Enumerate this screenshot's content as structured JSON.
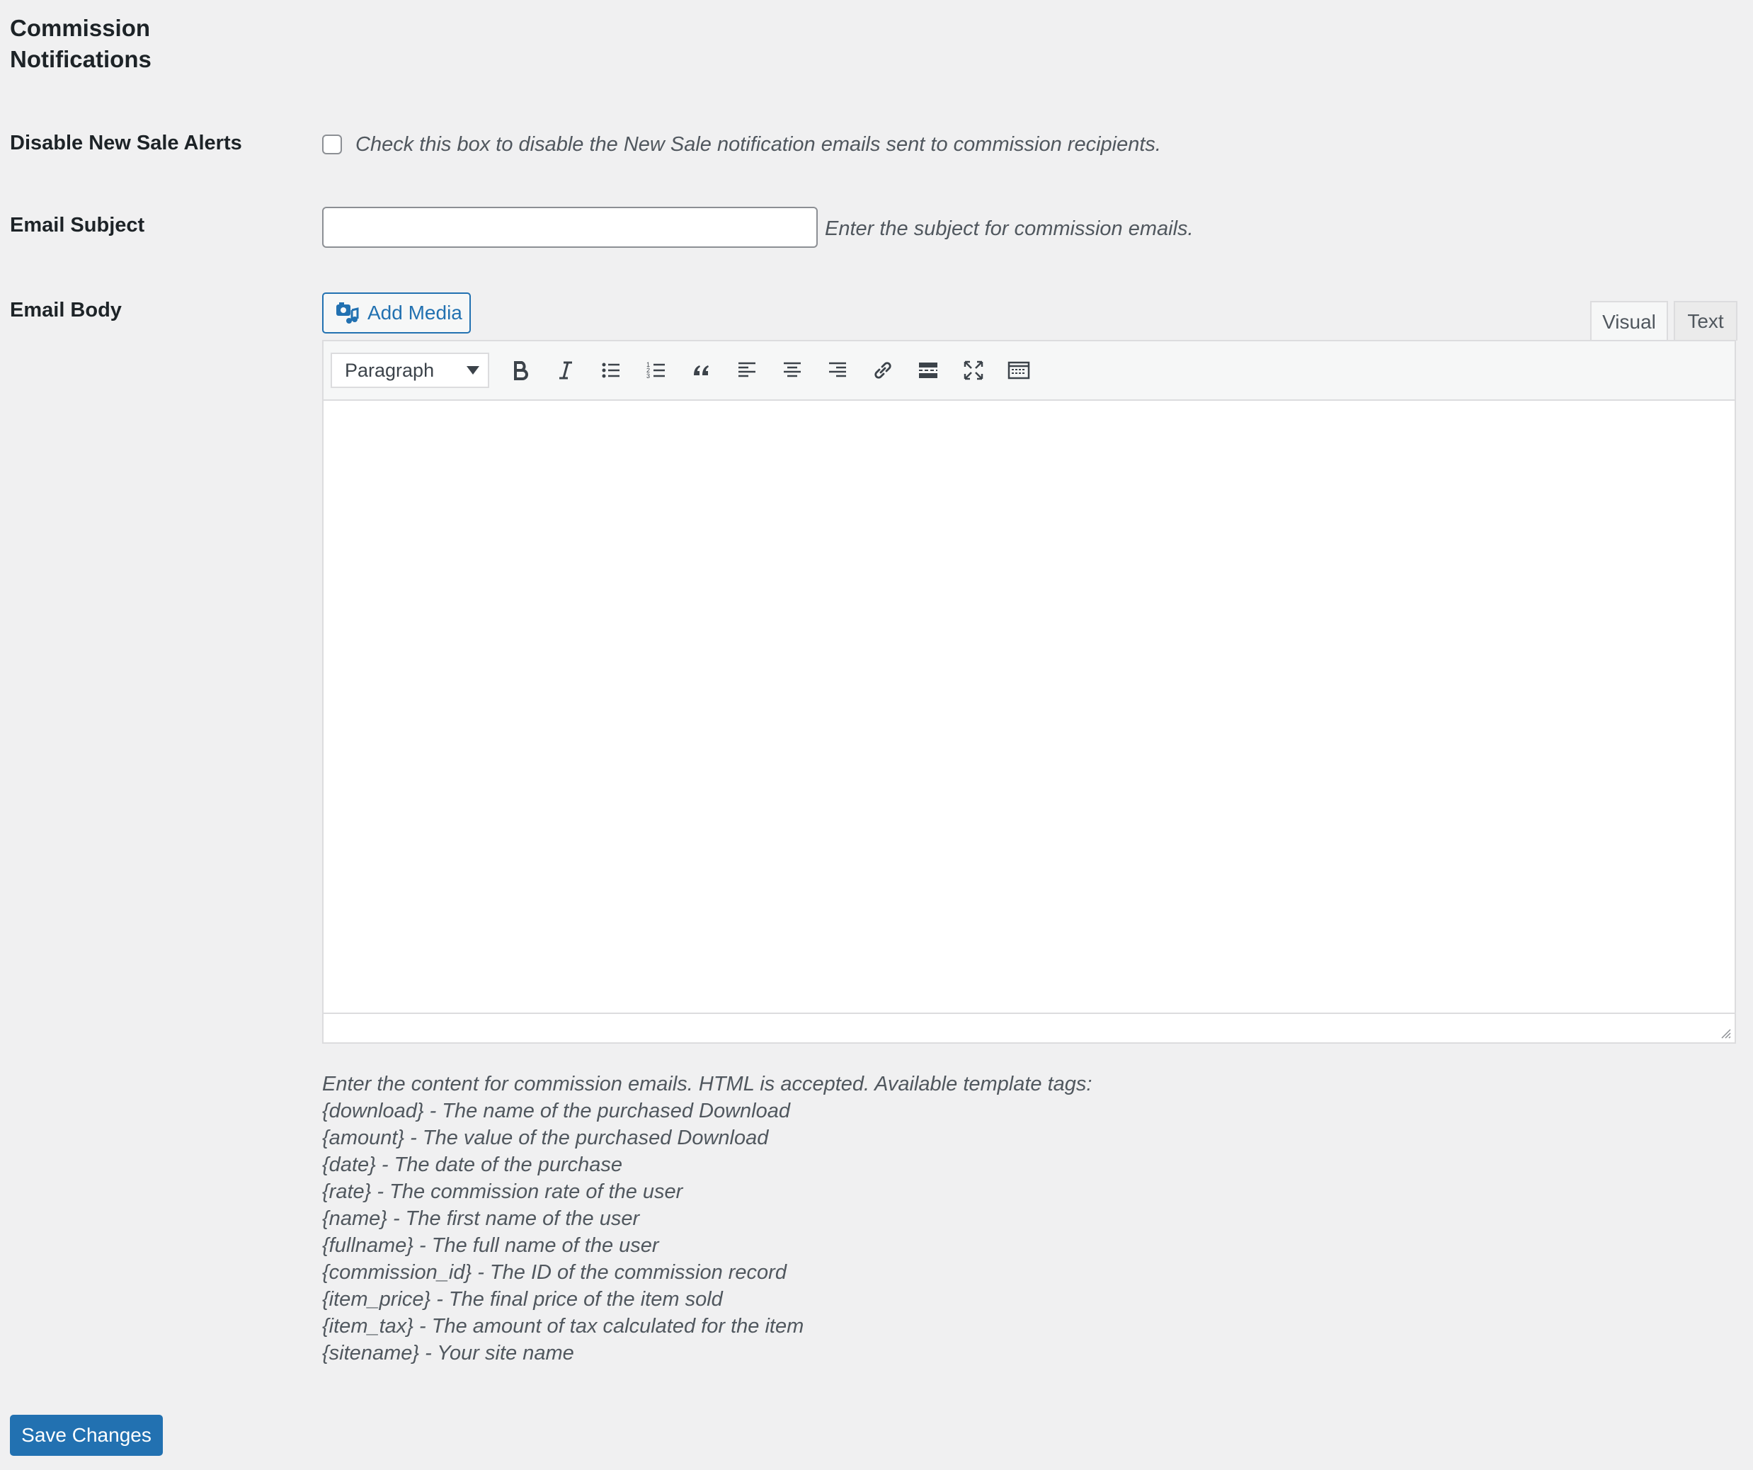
{
  "section": {
    "title_line1": "Commission",
    "title_line2": "Notifications"
  },
  "disable_alerts": {
    "label": "Disable New Sale Alerts",
    "checked": false,
    "description": "Check this box to disable the New Sale notification emails sent to commission recipients."
  },
  "email_subject": {
    "label": "Email Subject",
    "value": "",
    "placeholder": "",
    "description": "Enter the subject for commission emails."
  },
  "email_body": {
    "label": "Email Body",
    "add_media_label": "Add Media",
    "tabs": [
      {
        "label": "Visual",
        "active": true
      },
      {
        "label": "Text",
        "active": false
      }
    ],
    "format_select": "Paragraph",
    "toolbar_icons": [
      "bold-icon",
      "italic-icon",
      "bullet-list-icon",
      "numbered-list-icon",
      "blockquote-icon",
      "align-left-icon",
      "align-center-icon",
      "align-right-icon",
      "link-icon",
      "read-more-icon",
      "fullscreen-icon",
      "toolbar-toggle-icon"
    ],
    "content": ""
  },
  "help": {
    "intro": "Enter the content for commission emails. HTML is accepted. Available template tags:",
    "tags": [
      "{download} - The name of the purchased Download",
      "{amount} - The value of the purchased Download",
      "{date} - The date of the purchase",
      "{rate} - The commission rate of the user",
      "{name} - The first name of the user",
      "{fullname} - The full name of the user",
      "{commission_id} - The ID of the commission record",
      "{item_price} - The final price of the item sold",
      "{item_tax} - The amount of tax calculated for the item",
      "{sitename} - Your site name"
    ]
  },
  "save_label": "Save Changes",
  "colors": {
    "accent": "#2271b1",
    "background": "#f0f0f1",
    "text": "#1d2327",
    "muted": "#50575e"
  }
}
